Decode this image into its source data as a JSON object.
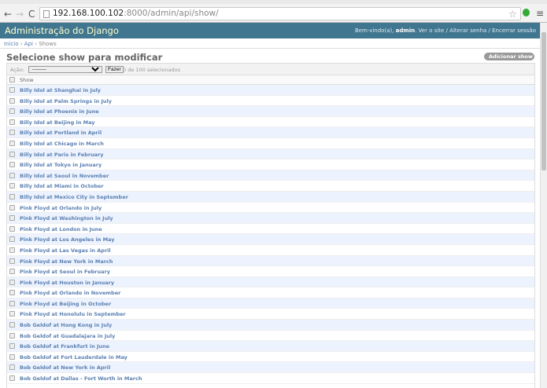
{
  "browser": {
    "url_host": "192.168.100.102",
    "url_rest": ":8000/admin/api/show/"
  },
  "header": {
    "brand": "Administração do Django",
    "welcome": "Bem-vindo(a),",
    "user": "admin",
    "links": ". Ver o site / Alterar senha / Encerrar sessão"
  },
  "breadcrumbs": {
    "home": "Início",
    "app": "Api",
    "current": "Shows",
    "sep": " › "
  },
  "title": "Selecione show para modificar",
  "add_button": "Adicionar show ✚",
  "actions": {
    "label": "Ação:",
    "select_value": "---------",
    "go": "Fazer",
    "count": "0 de 100 selecionados"
  },
  "column": "Show",
  "rows": [
    "Billy Idol at Shanghai in July",
    "Billy Idol at Palm Springs in July",
    "Billy Idol at Phoenix in June",
    "Billy Idol at Beijing in May",
    "Billy Idol at Portland in April",
    "Billy Idol at Chicago in March",
    "Billy Idol at Paris in February",
    "Billy Idol at Tokyo in January",
    "Billy Idol at Seoul in November",
    "Billy Idol at Miami in October",
    "Billy Idol at Mexico City in September",
    "Pink Floyd at Orlando in July",
    "Pink Floyd at Washington in July",
    "Pink Floyd at London in June",
    "Pink Floyd at Los Angeles in May",
    "Pink Floyd at Las Vegas in April",
    "Pink Floyd at New York in March",
    "Pink Floyd at Seoul in February",
    "Pink Floyd at Houston in January",
    "Pink Floyd at Orlando in November",
    "Pink Floyd at Beijing in October",
    "Pink Floyd at Honolulu in September",
    "Bob Geldof at Hong Kong in July",
    "Bob Geldof at Guadalajara in July",
    "Bob Geldof at Frankfurt in June",
    "Bob Geldof at Fort Lauderdale in May",
    "Bob Geldof at New York in April",
    "Bob Geldof at Dallas - Fort Worth in March"
  ]
}
